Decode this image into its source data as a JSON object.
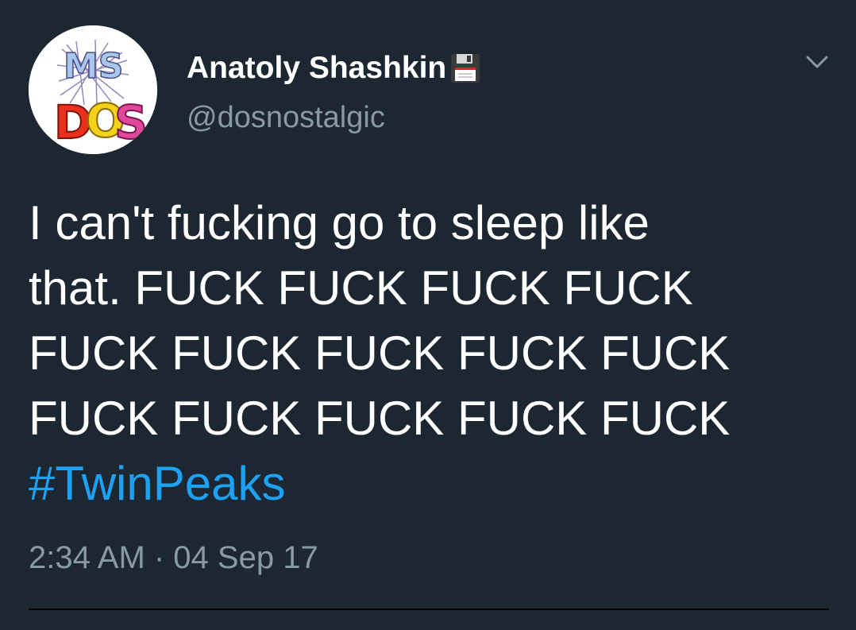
{
  "author": {
    "display_name": "Anatoly Shashkin",
    "name_emoji": "floppy-disk-icon",
    "handle": "@dosnostalgic",
    "avatar_text": [
      "MS",
      "DOS"
    ]
  },
  "tweet": {
    "lines": [
      "I can't fucking go to sleep like",
      "that. FUCK FUCK FUCK FUCK",
      "FUCK FUCK FUCK FUCK FUCK",
      "FUCK FUCK FUCK FUCK FUCK"
    ],
    "hashtag": "#TwinPeaks",
    "timestamp": "2:34 AM · 04 Sep 17"
  },
  "menu_icon": "chevron-down-icon",
  "colors": {
    "background": "#1c2732",
    "primary_text": "#ffffff",
    "secondary_text": "#8899a6",
    "link": "#1da1f2"
  }
}
